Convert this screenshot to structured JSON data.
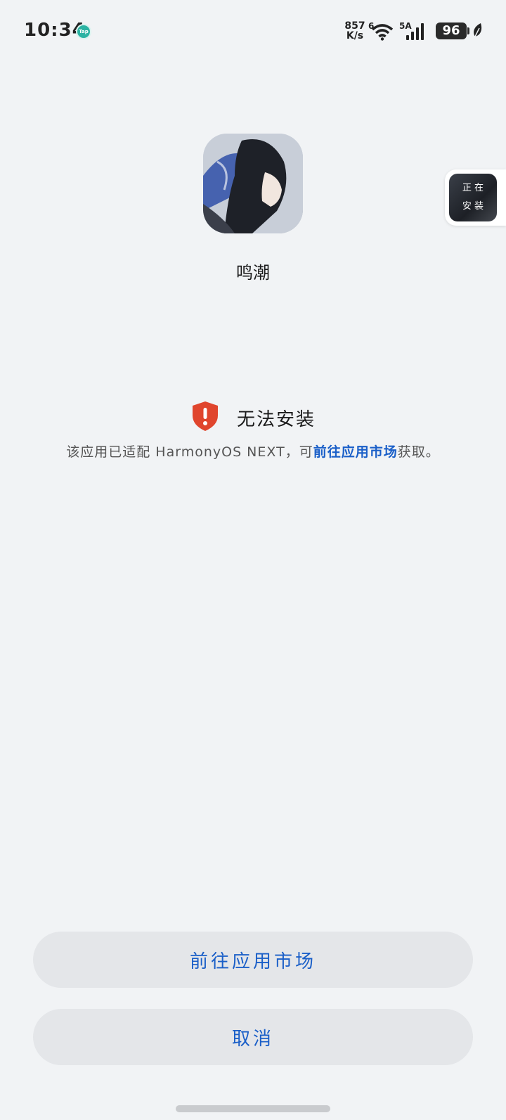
{
  "status_bar": {
    "time": "10:34",
    "net_speed_value": "857",
    "net_speed_unit": "K/s",
    "wifi_label": "6",
    "signal_label": "5A",
    "battery": "96",
    "notif_app": "Tap"
  },
  "app": {
    "name": "鸣潮",
    "icon": "app-icon-anime-character"
  },
  "floating_chip": {
    "label_line1": "正 在",
    "label_line2": "安 装"
  },
  "warning": {
    "title": "无法安装",
    "desc_prefix": "该应用已适配 HarmonyOS NEXT，可",
    "desc_link": "前往应用市场",
    "desc_suffix": "获取。",
    "icon": "shield-alert-icon",
    "icon_color": "#e0452d"
  },
  "buttons": {
    "market": "前往应用市场",
    "cancel": "取消"
  },
  "colors": {
    "accent": "#1a5fc8",
    "background": "#f1f3f5",
    "button_bg": "#e4e6e9"
  }
}
